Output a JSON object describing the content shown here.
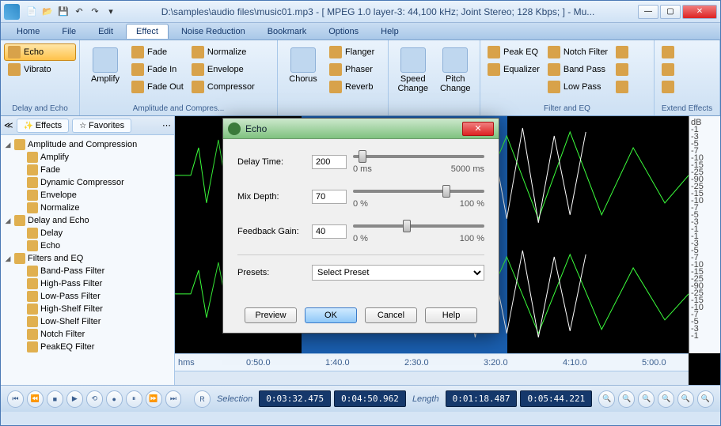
{
  "title": "D:\\samples\\audio files\\music01.mp3 - [ MPEG 1.0 layer-3: 44,100 kHz; Joint Stereo; 128 Kbps;  ] - Mu...",
  "menus": [
    "Home",
    "File",
    "Edit",
    "Effect",
    "Noise Reduction",
    "Bookmark",
    "Options",
    "Help"
  ],
  "active_menu": "Effect",
  "ribbon": {
    "g1": {
      "label": "Delay and Echo",
      "echo": "Echo",
      "vibrato": "Vibrato"
    },
    "g2": {
      "label": "Amplitude and Compres...",
      "amplify": "Amplify",
      "fade": "Fade",
      "fadein": "Fade In",
      "fadeout": "Fade Out",
      "normalize": "Normalize",
      "envelope": "Envelope",
      "compressor": "Compressor"
    },
    "g3": {
      "label": "",
      "chorus": "Chorus",
      "flanger": "Flanger",
      "phaser": "Phaser",
      "reverb": "Reverb"
    },
    "g4": {
      "label": "",
      "speed": "Speed Change",
      "pitch": "Pitch Change"
    },
    "g5": {
      "label": "Filter and EQ",
      "peakeq": "Peak EQ",
      "equalizer": "Equalizer",
      "notch": "Notch Filter",
      "bandpass": "Band Pass",
      "lowpass": "Low Pass"
    },
    "g6": {
      "label": "Extend Effects"
    }
  },
  "sidebar": {
    "tabs": {
      "effects": "Effects",
      "favorites": "Favorites"
    },
    "nodes": [
      {
        "t": "Amplitude and Compression",
        "lvl": 0,
        "exp": true
      },
      {
        "t": "Amplify",
        "lvl": 1
      },
      {
        "t": "Fade",
        "lvl": 1
      },
      {
        "t": "Dynamic Compressor",
        "lvl": 1
      },
      {
        "t": "Envelope",
        "lvl": 1
      },
      {
        "t": "Normalize",
        "lvl": 1
      },
      {
        "t": "Delay and Echo",
        "lvl": 0,
        "exp": true
      },
      {
        "t": "Delay",
        "lvl": 1
      },
      {
        "t": "Echo",
        "lvl": 1
      },
      {
        "t": "Filters and EQ",
        "lvl": 0,
        "exp": true
      },
      {
        "t": "Band-Pass Filter",
        "lvl": 1
      },
      {
        "t": "High-Pass Filter",
        "lvl": 1
      },
      {
        "t": "Low-Pass Filter",
        "lvl": 1
      },
      {
        "t": "High-Shelf Filter",
        "lvl": 1
      },
      {
        "t": "Low-Shelf Filter",
        "lvl": 1
      },
      {
        "t": "Notch Filter",
        "lvl": 1
      },
      {
        "t": "PeakEQ Filter",
        "lvl": 1
      }
    ]
  },
  "timeline": {
    "unit": "hms",
    "marks": [
      "0:50.0",
      "1:40.0",
      "2:30.0",
      "3:20.0",
      "4:10.0",
      "5:00.0"
    ]
  },
  "db_scale": [
    "dB",
    "-1",
    "-3",
    "-5",
    "-7",
    "-10",
    "-15",
    "-25",
    "-90",
    "-25",
    "-15",
    "-10",
    "-7",
    "-5",
    "-3",
    "-1"
  ],
  "transport": {
    "selection_label": "Selection",
    "sel_start": "0:03:32.475",
    "sel_end": "0:04:50.962",
    "length_label": "Length",
    "len": "0:01:18.487",
    "total": "0:05:44.221"
  },
  "dialog": {
    "title": "Echo",
    "delay_label": "Delay Time:",
    "delay_val": "200",
    "delay_min": "0 ms",
    "delay_max": "5000 ms",
    "mix_label": "Mix Depth:",
    "mix_val": "70",
    "mix_min": "0 %",
    "mix_max": "100 %",
    "fb_label": "Feedback Gain:",
    "fb_val": "40",
    "fb_min": "0 %",
    "fb_max": "100 %",
    "presets_label": "Presets:",
    "presets_value": "Select Preset",
    "preview": "Preview",
    "ok": "OK",
    "cancel": "Cancel",
    "help": "Help"
  }
}
